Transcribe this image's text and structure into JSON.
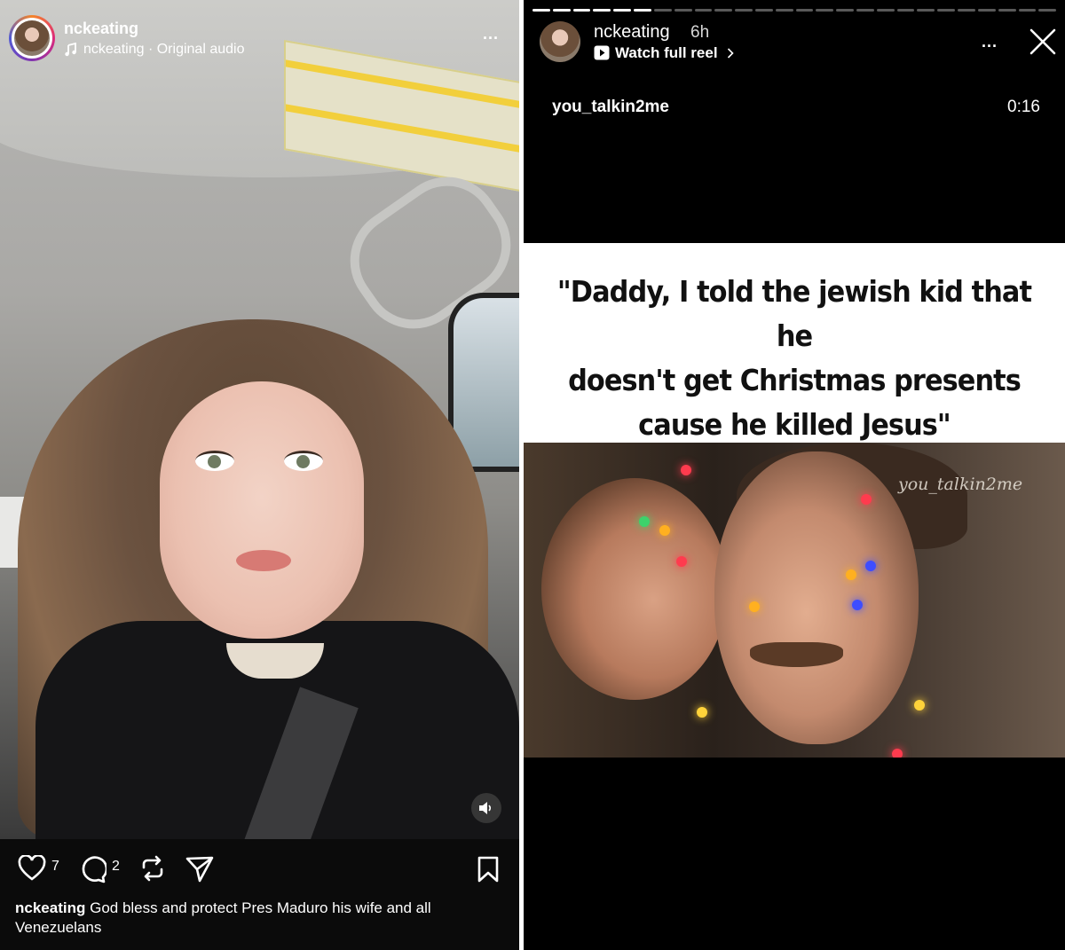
{
  "reel": {
    "username": "nckeating",
    "audio_user": "nckeating",
    "audio_label": "Original audio",
    "audio_separator": "·",
    "more_label": "...",
    "likes": "7",
    "comments": "2",
    "caption_user": "nckeating",
    "caption_text": "God bless and protect Pres Maduro his wife and all Venezuelans",
    "icons": [
      "music-note-icon",
      "heart-icon",
      "comment-icon",
      "repost-icon",
      "share-icon",
      "bookmark-icon",
      "speaker-icon"
    ]
  },
  "story": {
    "username": "nckeating",
    "time": "6h",
    "watch_label": "Watch full reel",
    "more_label": "...",
    "source_account": "you_talkin2me",
    "duration": "0:16",
    "meme_line1": "\"Daddy, I told the jewish kid that he",
    "meme_line2": "doesn't get Christmas presents",
    "meme_line3": "cause he killed Jesus\"",
    "watermark": "you_talkin2me",
    "progress_segments": 26,
    "progress_done": 6,
    "icons": [
      "play-icon",
      "close-icon",
      "chevron-right-icon"
    ]
  },
  "colors": {
    "background": "#000000",
    "text": "#ffffff",
    "meme_bg": "#ffffff",
    "meme_text": "#111111"
  }
}
